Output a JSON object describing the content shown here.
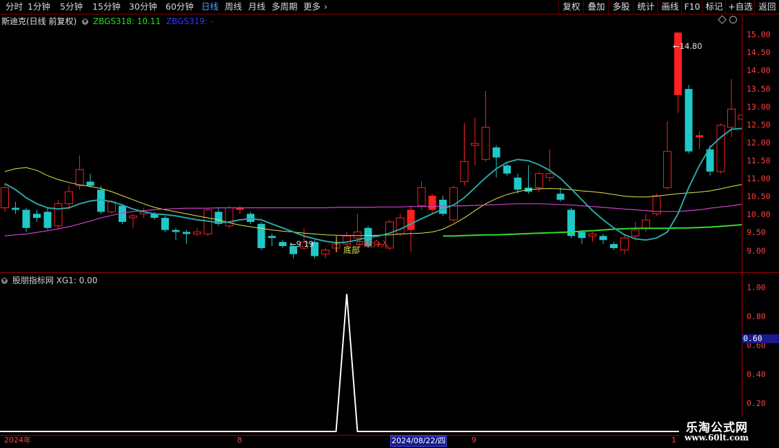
{
  "toolbar": {
    "periods": [
      "分时",
      "1分钟",
      "5分钟",
      "15分钟",
      "30分钟",
      "60分钟",
      "日线",
      "周线",
      "月线",
      "多周期",
      "更多"
    ],
    "active_period": "日线",
    "more_arrow": "›",
    "right_buttons": [
      "复权",
      "叠加",
      "多股",
      "统计",
      "画线",
      "F10",
      "标记",
      "+自选",
      "返回"
    ]
  },
  "main_panel": {
    "stock_title": "斯迪克(日线 前复权)",
    "indicator1": "ZBGS318: 10.11",
    "indicator2": "ZBGS319: -",
    "indicator1_color": "#22dd22",
    "indicator2_color": "#3333ff",
    "price_ticks": [
      "15.00",
      "14.50",
      "14.00",
      "13.50",
      "13.00",
      "12.50",
      "12.00",
      "11.50",
      "11.00",
      "10.50",
      "10.00",
      "9.50",
      "9.00"
    ],
    "high_label": "14.80",
    "low_label": "9.19",
    "signal_bottom": "底部",
    "signal_mid": "中线介入"
  },
  "sub_panel": {
    "title": "股朋指标网 XG1: 0.00",
    "ticks": [
      "1.00",
      "0.80",
      "0.60",
      "0.40",
      "0.20"
    ],
    "current_value": "0.60"
  },
  "date_axis": {
    "labels": [
      "2024年",
      "8",
      "9",
      "1"
    ],
    "cursor_date": "2024/08/22/四"
  },
  "watermark": {
    "line1": "乐淘公式网",
    "line2": "www.60lt.com"
  },
  "colors": {
    "up": "#ff2020",
    "down": "#20c8c8",
    "ma_yellow": "#e8e850",
    "ma_magenta": "#d040d0",
    "ma_teal": "#2aa8a8",
    "ma_green": "#30e030"
  },
  "chart_data": {
    "type": "candlestick",
    "ylim": [
      8.85,
      15.25
    ],
    "candles": [
      {
        "o": 10.45,
        "c": 10.95,
        "h": 11.05,
        "l": 10.35
      },
      {
        "o": 10.45,
        "c": 10.4,
        "h": 10.6,
        "l": 10.3
      },
      {
        "o": 10.4,
        "c": 9.95,
        "h": 10.45,
        "l": 9.85
      },
      {
        "o": 10.3,
        "c": 10.2,
        "h": 10.4,
        "l": 10.1
      },
      {
        "o": 10.35,
        "c": 9.95,
        "h": 10.45,
        "l": 9.9
      },
      {
        "o": 10.0,
        "c": 10.55,
        "h": 10.65,
        "l": 9.95
      },
      {
        "o": 10.55,
        "c": 10.85,
        "h": 11.0,
        "l": 10.4
      },
      {
        "o": 11.0,
        "c": 11.4,
        "h": 11.75,
        "l": 10.9
      },
      {
        "o": 11.1,
        "c": 11.0,
        "h": 11.3,
        "l": 10.95
      },
      {
        "o": 10.9,
        "c": 10.35,
        "h": 11.0,
        "l": 10.3
      },
      {
        "o": 10.35,
        "c": 10.6,
        "h": 10.65,
        "l": 10.3
      },
      {
        "o": 10.5,
        "c": 10.1,
        "h": 10.55,
        "l": 10.05
      },
      {
        "o": 10.2,
        "c": 10.25,
        "h": 10.3,
        "l": 9.95
      },
      {
        "o": 10.3,
        "c": 10.35,
        "h": 10.45,
        "l": 10.2
      },
      {
        "o": 10.3,
        "c": 10.2,
        "h": 10.35,
        "l": 10.15
      },
      {
        "o": 10.2,
        "c": 9.9,
        "h": 10.25,
        "l": 9.85
      },
      {
        "o": 9.9,
        "c": 9.85,
        "h": 9.95,
        "l": 9.65
      },
      {
        "o": 9.85,
        "c": 9.8,
        "h": 9.9,
        "l": 9.55
      },
      {
        "o": 9.8,
        "c": 9.85,
        "h": 9.95,
        "l": 9.75
      },
      {
        "o": 9.8,
        "c": 10.4,
        "h": 10.45,
        "l": 9.75
      },
      {
        "o": 10.35,
        "c": 10.05,
        "h": 10.45,
        "l": 10.0
      },
      {
        "o": 10.0,
        "c": 10.45,
        "h": 10.5,
        "l": 9.95
      },
      {
        "o": 10.4,
        "c": 10.45,
        "h": 10.5,
        "l": 10.3
      },
      {
        "o": 10.3,
        "c": 10.1,
        "h": 10.35,
        "l": 10.05
      },
      {
        "o": 10.05,
        "c": 9.45,
        "h": 10.1,
        "l": 9.4
      },
      {
        "o": 9.75,
        "c": 9.7,
        "h": 9.8,
        "l": 9.5
      },
      {
        "o": 9.6,
        "c": 9.5,
        "h": 9.65,
        "l": 9.45
      },
      {
        "o": 9.5,
        "c": 9.3,
        "h": 9.55,
        "l": 9.2
      },
      {
        "o": 9.45,
        "c": 9.6,
        "h": 9.95,
        "l": 9.4
      },
      {
        "o": 9.6,
        "c": 9.25,
        "h": 9.65,
        "l": 9.19
      },
      {
        "o": 9.3,
        "c": 9.4,
        "h": 9.45,
        "l": 9.2
      },
      {
        "o": 9.45,
        "c": 9.55,
        "h": 9.65,
        "l": 9.35
      },
      {
        "o": 9.55,
        "c": 9.75,
        "h": 9.85,
        "l": 9.5
      },
      {
        "o": 9.7,
        "c": 9.85,
        "h": 10.3,
        "l": 9.6
      },
      {
        "o": 9.95,
        "c": 9.5,
        "h": 10.0,
        "l": 9.45
      },
      {
        "o": 9.55,
        "c": 9.55,
        "h": 9.6,
        "l": 9.5
      },
      {
        "o": 9.45,
        "c": 10.1,
        "h": 10.15,
        "l": 9.4
      },
      {
        "o": 9.8,
        "c": 10.2,
        "h": 10.3,
        "l": 9.75
      },
      {
        "o": 9.9,
        "c": 10.4,
        "h": 10.5,
        "l": 9.35
      },
      {
        "o": 10.5,
        "c": 10.95,
        "h": 11.1,
        "l": 10.4
      },
      {
        "o": 10.4,
        "c": 10.75,
        "h": 10.8,
        "l": 10.3
      },
      {
        "o": 10.65,
        "c": 10.3,
        "h": 10.75,
        "l": 10.25
      },
      {
        "o": 10.15,
        "c": 10.95,
        "h": 11.0,
        "l": 10.1
      },
      {
        "o": 11.1,
        "c": 11.6,
        "h": 12.55,
        "l": 11.0
      },
      {
        "o": 12.0,
        "c": 12.05,
        "h": 12.7,
        "l": 11.5
      },
      {
        "o": 11.65,
        "c": 12.45,
        "h": 13.35,
        "l": 11.6
      },
      {
        "o": 11.95,
        "c": 11.7,
        "h": 12.0,
        "l": 11.2
      },
      {
        "o": 11.5,
        "c": 11.3,
        "h": 11.55,
        "l": 11.25
      },
      {
        "o": 11.2,
        "c": 10.9,
        "h": 11.3,
        "l": 10.8
      },
      {
        "o": 10.95,
        "c": 10.85,
        "h": 11.5,
        "l": 10.8
      },
      {
        "o": 10.95,
        "c": 11.3,
        "h": 11.35,
        "l": 10.85
      },
      {
        "o": 11.2,
        "c": 11.3,
        "h": 11.9,
        "l": 11.1
      },
      {
        "o": 10.8,
        "c": 10.65,
        "h": 10.95,
        "l": 10.6
      },
      {
        "o": 10.4,
        "c": 9.75,
        "h": 10.45,
        "l": 9.7
      },
      {
        "o": 9.85,
        "c": 9.7,
        "h": 9.9,
        "l": 9.55
      },
      {
        "o": 9.75,
        "c": 9.8,
        "h": 9.85,
        "l": 9.6
      },
      {
        "o": 9.75,
        "c": 9.65,
        "h": 9.8,
        "l": 9.55
      },
      {
        "o": 9.55,
        "c": 9.45,
        "h": 9.6,
        "l": 9.4
      },
      {
        "o": 9.4,
        "c": 9.7,
        "h": 9.8,
        "l": 9.3
      },
      {
        "o": 9.75,
        "c": 9.9,
        "h": 10.1,
        "l": 9.7
      },
      {
        "o": 9.95,
        "c": 10.15,
        "h": 10.3,
        "l": 9.85
      },
      {
        "o": 10.3,
        "c": 10.75,
        "h": 10.8,
        "l": 10.25
      },
      {
        "o": 10.95,
        "c": 11.85,
        "h": 12.6,
        "l": 10.9
      },
      {
        "o": 13.25,
        "c": 14.8,
        "h": 14.82,
        "l": 12.8
      },
      {
        "o": 13.4,
        "c": 11.85,
        "h": 13.5,
        "l": 11.8
      },
      {
        "o": 12.2,
        "c": 12.25,
        "h": 12.35,
        "l": 11.9
      },
      {
        "o": 11.9,
        "c": 11.35,
        "h": 12.0,
        "l": 11.25
      },
      {
        "o": 11.35,
        "c": 12.5,
        "h": 12.55,
        "l": 11.3
      },
      {
        "o": 12.45,
        "c": 12.9,
        "h": 13.65,
        "l": 12.2
      },
      {
        "o": 12.65,
        "c": 12.75,
        "h": 13.3,
        "l": 12.5
      }
    ],
    "ma_teal": [
      11.05,
      10.9,
      10.7,
      10.55,
      10.45,
      10.42,
      10.45,
      10.55,
      10.62,
      10.65,
      10.6,
      10.52,
      10.42,
      10.35,
      10.3,
      10.28,
      10.25,
      10.2,
      10.15,
      10.12,
      10.08,
      10.1,
      10.15,
      10.18,
      10.15,
      10.05,
      9.95,
      9.85,
      9.75,
      9.68,
      9.62,
      9.58,
      9.6,
      9.65,
      9.72,
      9.75,
      9.82,
      9.92,
      10.05,
      10.18,
      10.3,
      10.42,
      10.52,
      10.7,
      10.95,
      11.2,
      11.42,
      11.58,
      11.65,
      11.62,
      11.52,
      11.38,
      11.18,
      10.92,
      10.65,
      10.38,
      10.15,
      9.95,
      9.78,
      9.68,
      9.65,
      9.7,
      9.85,
      10.3,
      10.95,
      11.5,
      11.95,
      12.2,
      12.4,
      12.42
    ],
    "ma_yellow": [
      11.35,
      11.42,
      11.45,
      11.38,
      11.25,
      11.15,
      11.08,
      11.02,
      10.98,
      10.93,
      10.85,
      10.75,
      10.65,
      10.55,
      10.46,
      10.4,
      10.35,
      10.3,
      10.25,
      10.2,
      10.15,
      10.08,
      10.02,
      9.98,
      9.94,
      9.9,
      9.87,
      9.85,
      9.82,
      9.8,
      9.78,
      9.77,
      9.76,
      9.76,
      9.76,
      9.77,
      9.78,
      9.8,
      9.81,
      9.82,
      9.85,
      9.92,
      10.05,
      10.2,
      10.38,
      10.55,
      10.68,
      10.78,
      10.85,
      10.9,
      10.92,
      10.93,
      10.92,
      10.9,
      10.87,
      10.85,
      10.82,
      10.78,
      10.74,
      10.72,
      10.72,
      10.74,
      10.77,
      10.8,
      10.82,
      10.84,
      10.87,
      10.92,
      10.98,
      11.03
    ],
    "ma_magenta": [
      9.75,
      9.78,
      9.8,
      9.84,
      9.88,
      9.93,
      9.98,
      10.05,
      10.12,
      10.2,
      10.26,
      10.32,
      10.36,
      10.38,
      10.4,
      10.42,
      10.43,
      10.44,
      10.44,
      10.44,
      10.45,
      10.45,
      10.45,
      10.45,
      10.45,
      10.45,
      10.45,
      10.45,
      10.45,
      10.45,
      10.45,
      10.46,
      10.46,
      10.46,
      10.46,
      10.47,
      10.47,
      10.47,
      10.48,
      10.48,
      10.48,
      10.49,
      10.5,
      10.5,
      10.51,
      10.52,
      10.53,
      10.54,
      10.55,
      10.55,
      10.55,
      10.54,
      10.53,
      10.52,
      10.5,
      10.48,
      10.46,
      10.44,
      10.42,
      10.4,
      10.38,
      10.36,
      10.36,
      10.36,
      10.38,
      10.4,
      10.44,
      10.47,
      10.5,
      10.54
    ],
    "ma_green_start": 41,
    "ma_green": [
      9.75,
      9.75,
      9.76,
      9.77,
      9.78,
      9.78,
      9.79,
      9.8,
      9.81,
      9.82,
      9.83,
      9.84,
      9.85,
      9.87,
      9.88,
      9.9,
      9.92,
      9.93,
      9.94,
      9.94,
      9.94,
      9.94,
      9.95,
      9.95,
      9.96,
      9.97,
      9.99,
      10.01,
      10.03,
      10.05,
      10.08,
      10.1,
      10.12
    ],
    "xg1": {
      "peak_index": 32,
      "peak_value": 1.0,
      "ylim": [
        0,
        1.05
      ]
    }
  }
}
